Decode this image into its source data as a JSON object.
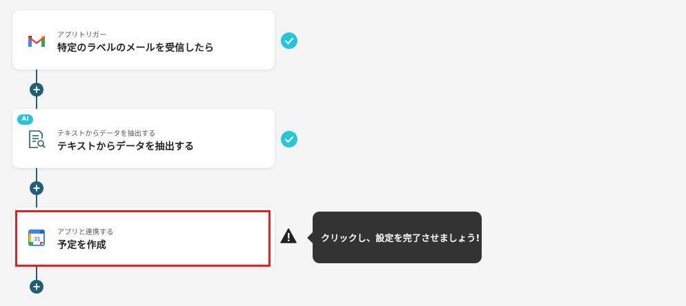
{
  "flow": {
    "steps": [
      {
        "subtitle": "アプリトリガー",
        "title": "特定のラベルのメールを受信したら",
        "icon": "gmail-icon",
        "status": "complete"
      },
      {
        "badge": "AI",
        "subtitle": "テキストからデータを抽出する",
        "title": "テキストからデータを抽出する",
        "icon": "document-search-icon",
        "status": "complete"
      },
      {
        "subtitle": "アプリと連携する",
        "title": "予定を作成",
        "icon": "google-calendar-icon",
        "status": "warning",
        "calendar_day": "31"
      }
    ],
    "tooltip": "クリックし、設定を完了させましょう!"
  },
  "colors": {
    "accent": "#26c6da",
    "connector": "#1f5f78",
    "highlight": "#e02020",
    "tooltip_bg": "#333333"
  }
}
